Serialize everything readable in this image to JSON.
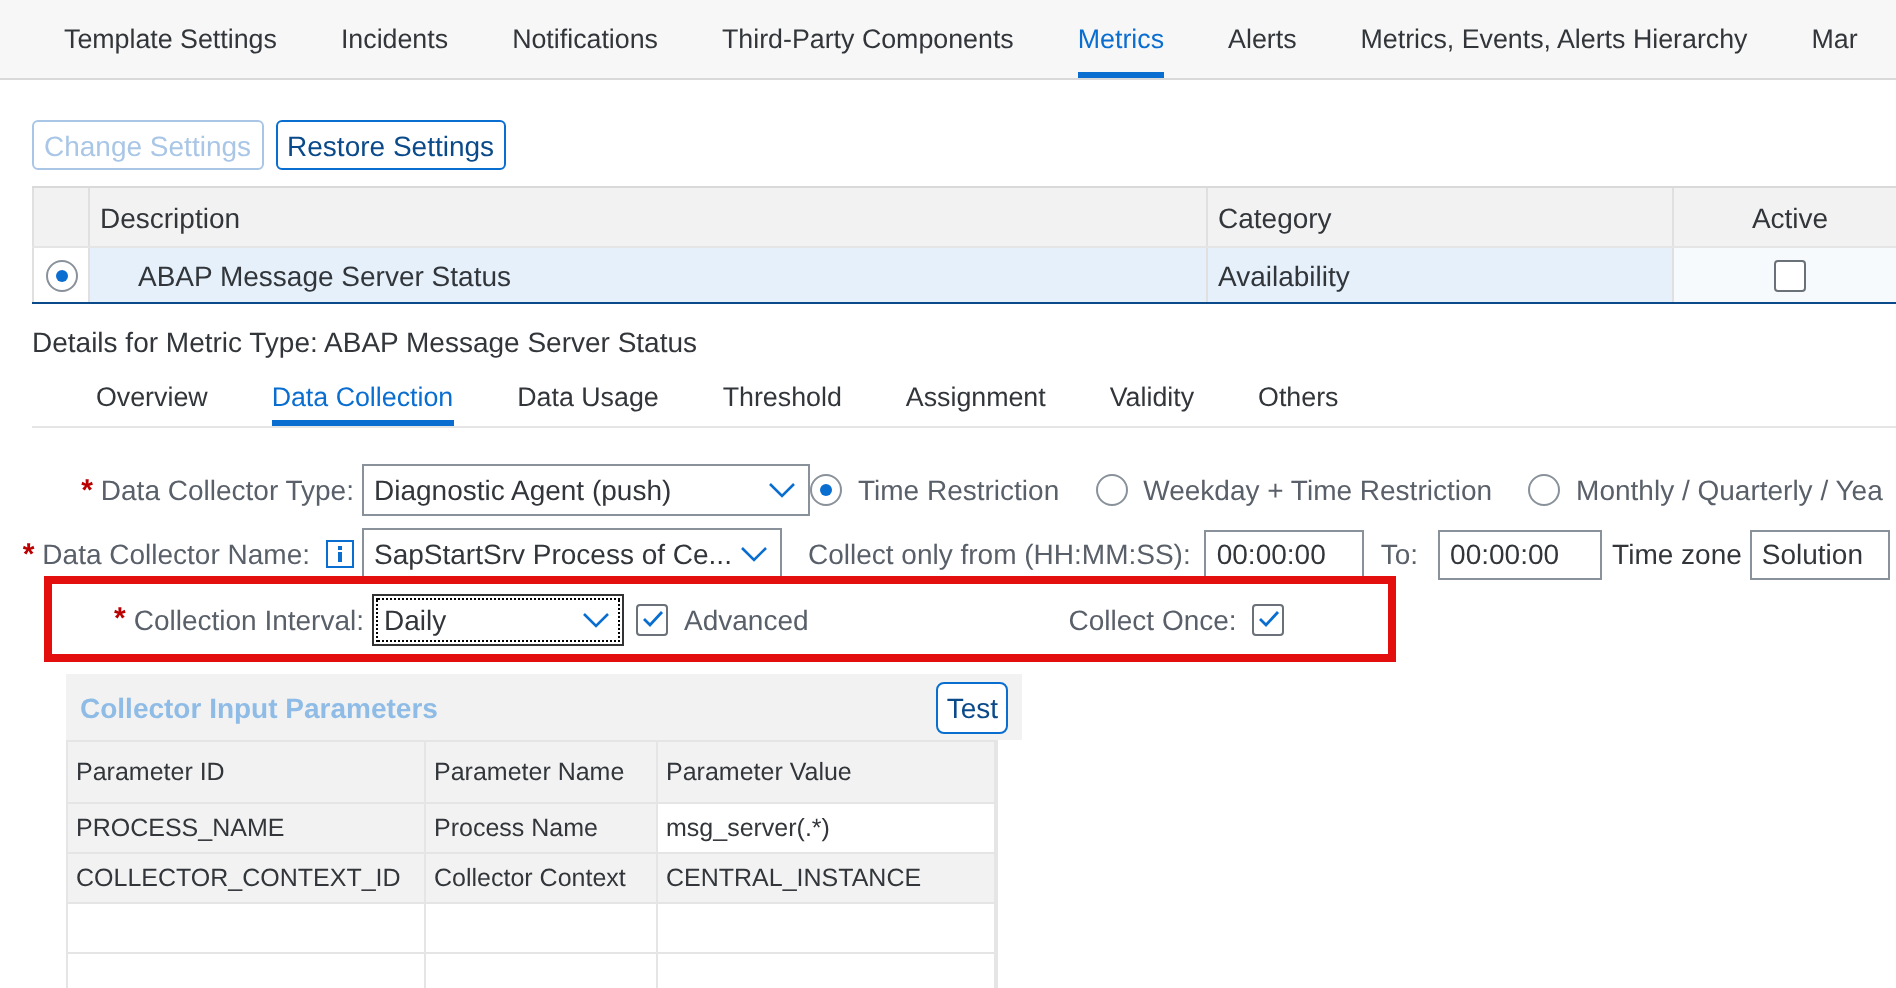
{
  "tabs": [
    {
      "label": "Template Settings",
      "selected": false
    },
    {
      "label": "Incidents",
      "selected": false
    },
    {
      "label": "Notifications",
      "selected": false
    },
    {
      "label": "Third-Party Components",
      "selected": false
    },
    {
      "label": "Metrics",
      "selected": true
    },
    {
      "label": "Alerts",
      "selected": false
    },
    {
      "label": "Metrics, Events, Alerts Hierarchy",
      "selected": false
    },
    {
      "label": "Mar",
      "selected": false
    }
  ],
  "buttons": [
    {
      "label": "Change Settings",
      "disabled": true
    },
    {
      "label": "Restore Settings",
      "disabled": false
    }
  ],
  "metrics_table": {
    "columns": [
      "Description",
      "Category",
      "Active"
    ],
    "rows": [
      {
        "selected": true,
        "description": "ABAP Message Server Status",
        "category": "Availability",
        "active": false
      }
    ]
  },
  "details_title": "Details for Metric Type: ABAP Message Server Status",
  "detail_tabs": [
    {
      "label": "Overview",
      "selected": false
    },
    {
      "label": "Data Collection",
      "selected": true
    },
    {
      "label": "Data Usage",
      "selected": false
    },
    {
      "label": "Threshold",
      "selected": false
    },
    {
      "label": "Assignment",
      "selected": false
    },
    {
      "label": "Validity",
      "selected": false
    },
    {
      "label": "Others",
      "selected": false
    }
  ],
  "collector_type": {
    "required_mark": "*",
    "label": "Data Collector Type:",
    "value": "Diagnostic Agent (push)"
  },
  "restriction_options": [
    {
      "label": "Time Restriction",
      "selected": true
    },
    {
      "label": "Weekday + Time Restriction",
      "selected": false
    },
    {
      "label": "Monthly / Quarterly / Yea",
      "selected": false
    }
  ],
  "collector_name": {
    "required_mark": "*",
    "label": "Data Collector Name:",
    "value": "SapStartSrv Process of Ce..."
  },
  "collect_from": {
    "label": "Collect only from (HH:MM:SS):",
    "value": "00:00:00"
  },
  "collect_to": {
    "label": "To:",
    "value": "00:00:00"
  },
  "time_zone": {
    "label": "Time zone",
    "value": "Solution"
  },
  "collection_interval": {
    "required_mark": "*",
    "label": "Collection Interval:",
    "value": "Daily",
    "focused": true
  },
  "advanced": {
    "label": "Advanced",
    "checked": true
  },
  "collect_once": {
    "label": "Collect Once:",
    "checked": true
  },
  "parameters": {
    "title": "Collector Input Parameters",
    "test_button": "Test",
    "columns": [
      "Parameter ID",
      "Parameter Name",
      "Parameter Value"
    ],
    "rows": [
      {
        "id": "PROCESS_NAME",
        "name": "Process Name",
        "value": "msg_server(.*)",
        "editable": true
      },
      {
        "id": "COLLECTOR_CONTEXT_ID",
        "name": "Collector Context",
        "value": "CENTRAL_INSTANCE",
        "editable": false
      }
    ]
  }
}
